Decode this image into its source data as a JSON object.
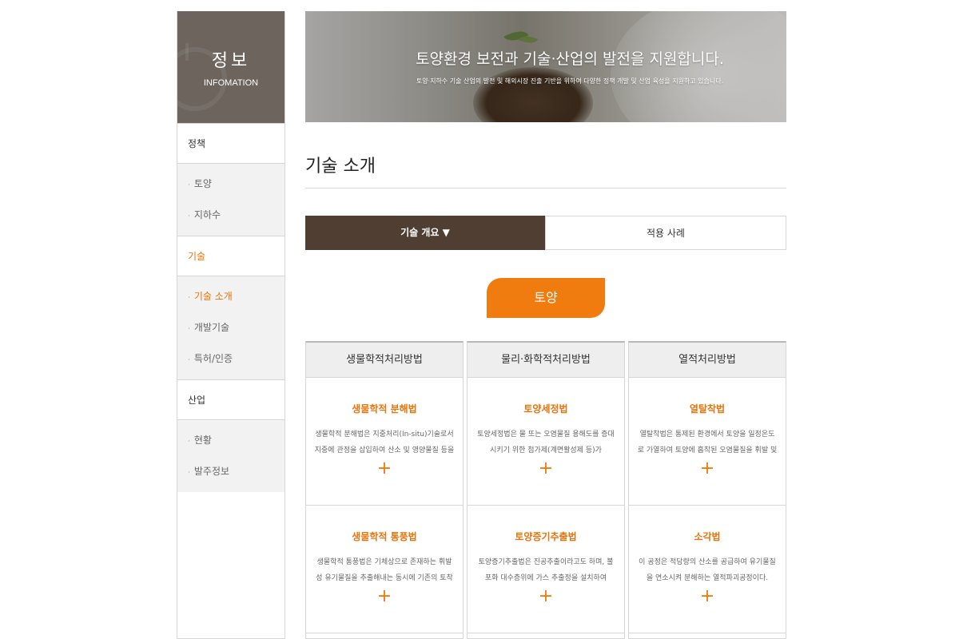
{
  "sidebar": {
    "title": "정보",
    "subtitle": "INFOMATION",
    "groups": [
      {
        "label": "정책",
        "items": [
          "토양",
          "지하수"
        ]
      },
      {
        "label": "기술",
        "items": [
          "기술 소개",
          "개발기술",
          "특허/인증"
        ]
      },
      {
        "label": "산업",
        "items": [
          "현황",
          "발주정보"
        ]
      }
    ],
    "bullet": "·"
  },
  "banner": {
    "headline": "토양환경 보전과 기술·산업의 발전을 지원합니다.",
    "description": "토양·지하수 기술 산업의 발전 및 해외시장 진출 기반을 위하여 다양한 정책 개발 및 산업 육성을 지원하고 있습니다."
  },
  "page_title": "기술 소개",
  "tabs": {
    "overview": "기술 개요 ▼",
    "cases": "적용 사례"
  },
  "category_button": "토양",
  "columns": [
    {
      "header": "생물학적처리방법",
      "cards": [
        {
          "title": "생물학적 분해법",
          "text": "생물학적 분해법은 지중처리(In-situ)기술로서 지중에 관정을 삽입하여 산소 및 영양물질 등을",
          "plus": "+"
        },
        {
          "title": "생물학적 통풍법",
          "text": "생물학적 통풍법은 기체상으로 존재하는 휘발성 유기물질을 추출해내는 동시에 기존의 토착",
          "plus": "+"
        }
      ]
    },
    {
      "header": "물리·화학적처리방법",
      "cards": [
        {
          "title": "토양세정법",
          "text": "토양세정법은 물 또는 오염물질 용해도를 증대시키기 위한 첨가제(계면활성제 등)가",
          "plus": "+"
        },
        {
          "title": "토양증기추출법",
          "text": "토양증기추출법은 진공추출이라고도 하며, 불포화 대수층위에 가스 추출정을 설치하여",
          "plus": "+"
        }
      ]
    },
    {
      "header": "열적처리방법",
      "cards": [
        {
          "title": "열탈착법",
          "text": "열탈착법은 통제된 환경에서 토양을 일정온도로 가열하여 토양에 흡착된 오염물질을 휘발 및",
          "plus": "+"
        },
        {
          "title": "소각법",
          "text": "이 공정은 적당량의 산소를 공급하여 유기물질을 연소시켜 분해하는 열적파괴공정이다.",
          "plus": "+"
        }
      ]
    }
  ],
  "colors": {
    "accent": "#f07b0f",
    "accent_text": "#e8740c",
    "tab_active": "#4f3e31",
    "sidebar_head": "#6c645d"
  }
}
